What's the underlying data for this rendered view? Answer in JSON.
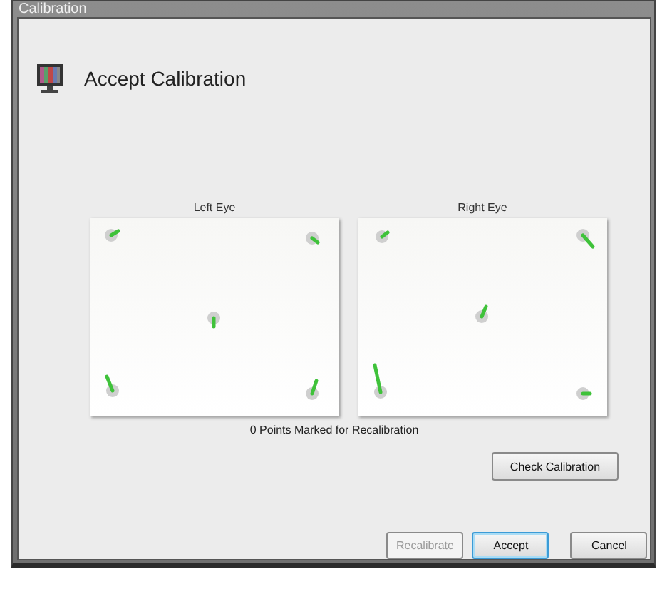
{
  "window": {
    "title": "Calibration"
  },
  "header": {
    "title": "Accept Calibration"
  },
  "eyes": [
    {
      "label": "Left Eye",
      "kind": "left"
    },
    {
      "label": "Right Eye",
      "kind": "right"
    }
  ],
  "status": "0 Points Marked for Recalibration",
  "check_button": {
    "label": "Check Calibration"
  },
  "buttons": [
    {
      "label": "Recalibrate",
      "disabled": true,
      "focused": false
    },
    {
      "label": "Accept",
      "disabled": false,
      "focused": true
    },
    {
      "label": "Cancel",
      "disabled": false,
      "focused": false
    }
  ]
}
